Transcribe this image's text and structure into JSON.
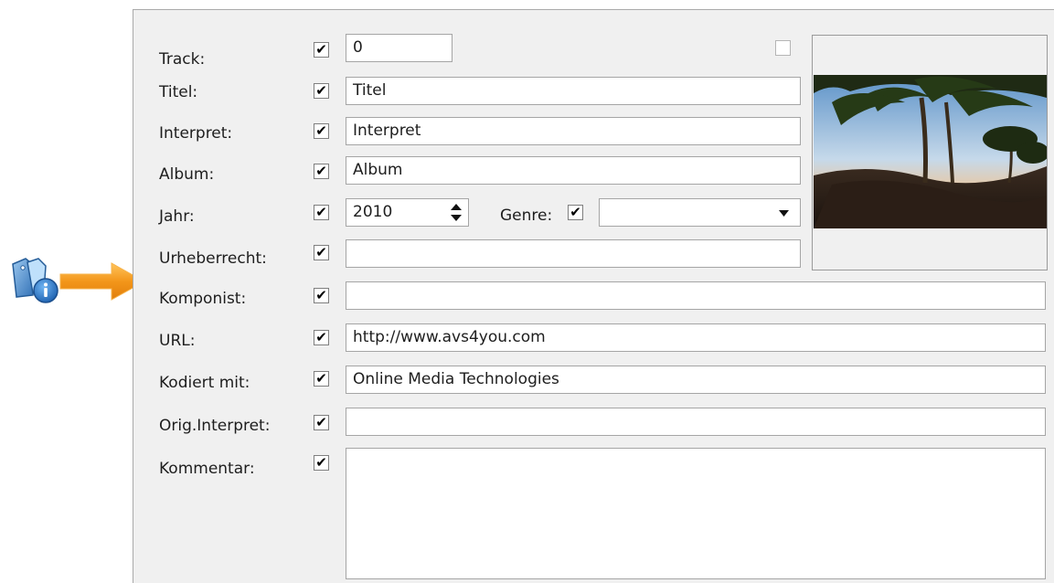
{
  "labels": {
    "track": "Track:",
    "title": "Titel:",
    "artist": "Interpret:",
    "album": "Album:",
    "year": "Jahr:",
    "genre": "Genre:",
    "copyright": "Urheberrecht:",
    "composer": "Komponist:",
    "url": "URL:",
    "encoded_by": "Kodiert mit:",
    "orig_artist": "Orig.Interpret:",
    "comment": "Kommentar:"
  },
  "values": {
    "track": "0",
    "title": "Titel",
    "artist": "Interpret",
    "album": "Album",
    "year": "2010",
    "genre": "",
    "copyright": "",
    "composer": "",
    "url": "http://www.avs4you.com",
    "encoded_by": "Online Media Technologies",
    "orig_artist": "",
    "comment": ""
  },
  "checkmark": "✔",
  "icons": {
    "tag_info": "tag-info-icon",
    "pointer_arrow": "orange-arrow-icon",
    "dropdown": "chevron-down-icon",
    "spin": "spin-arrows-icon"
  },
  "colors": {
    "panel": "#f0f0f0",
    "arrow": "#f39a1e",
    "info_blue": "#2a78c8"
  }
}
